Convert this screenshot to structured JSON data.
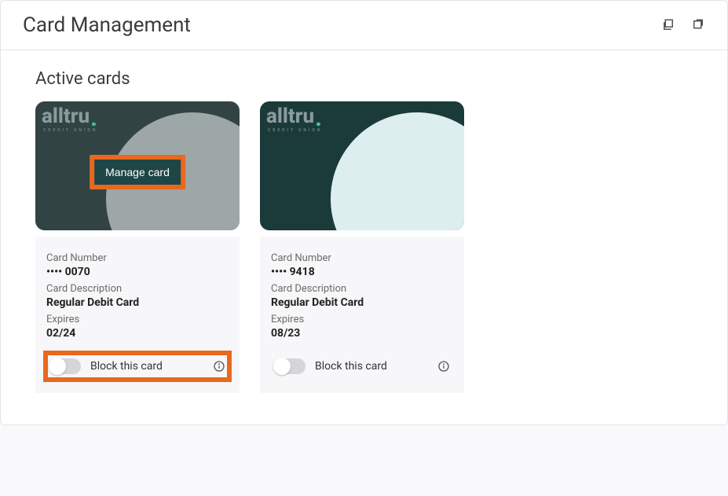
{
  "header": {
    "title": "Card Management"
  },
  "section": {
    "title": "Active cards"
  },
  "brand": {
    "name": "alltru",
    "sub": "CREDIT UNION"
  },
  "manage_card_label": "Manage card",
  "labels": {
    "card_number": "Card Number",
    "card_description": "Card Description",
    "expires": "Expires",
    "block_this_card": "Block this card"
  },
  "cards": [
    {
      "number_masked": "•••• 0070",
      "description": "Regular Debit Card",
      "expires": "02/24",
      "hovered": true,
      "block_highlighted": true
    },
    {
      "number_masked": "•••• 9418",
      "description": "Regular Debit Card",
      "expires": "08/23",
      "hovered": false,
      "block_highlighted": false
    }
  ]
}
